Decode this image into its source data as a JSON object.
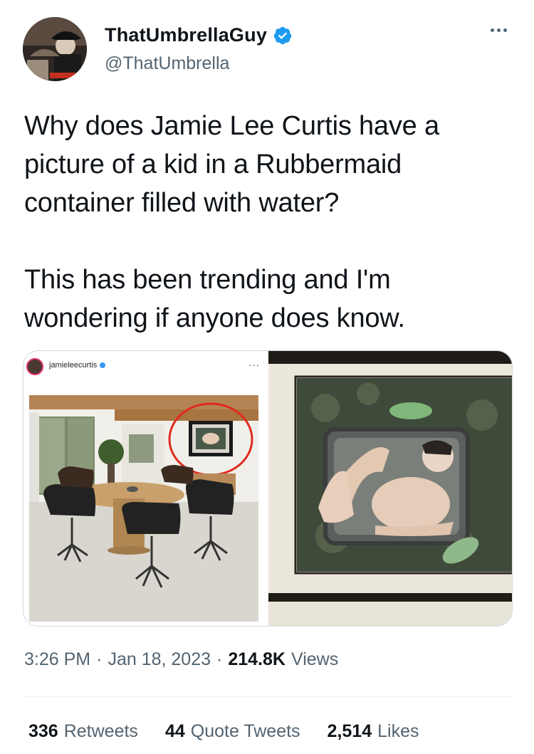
{
  "author": {
    "display_name": "ThatUmbrellaGuy",
    "handle": "@ThatUmbrella",
    "verified": true,
    "verified_color": "#1d9bf0"
  },
  "tweet": {
    "paragraphs": [
      "Why does Jamie Lee Curtis have a picture of a kid in a Rubbermaid container filled with water?",
      "This has been trending and I'm wondering if anyone does know."
    ]
  },
  "media": {
    "left_image": {
      "ig_username": "jamieleecurtis",
      "ig_more": "···"
    }
  },
  "meta": {
    "time": "3:26 PM",
    "separator": "·",
    "date": "Jan 18, 2023",
    "views_count": "214.8K",
    "views_label": "Views"
  },
  "stats": {
    "retweets_count": "336",
    "retweets_label": "Retweets",
    "quotes_count": "44",
    "quotes_label": "Quote Tweets",
    "likes_count": "2,514",
    "likes_label": "Likes"
  },
  "icons": {
    "verified": "verified-badge-icon",
    "more": "more-horizontal-icon"
  }
}
